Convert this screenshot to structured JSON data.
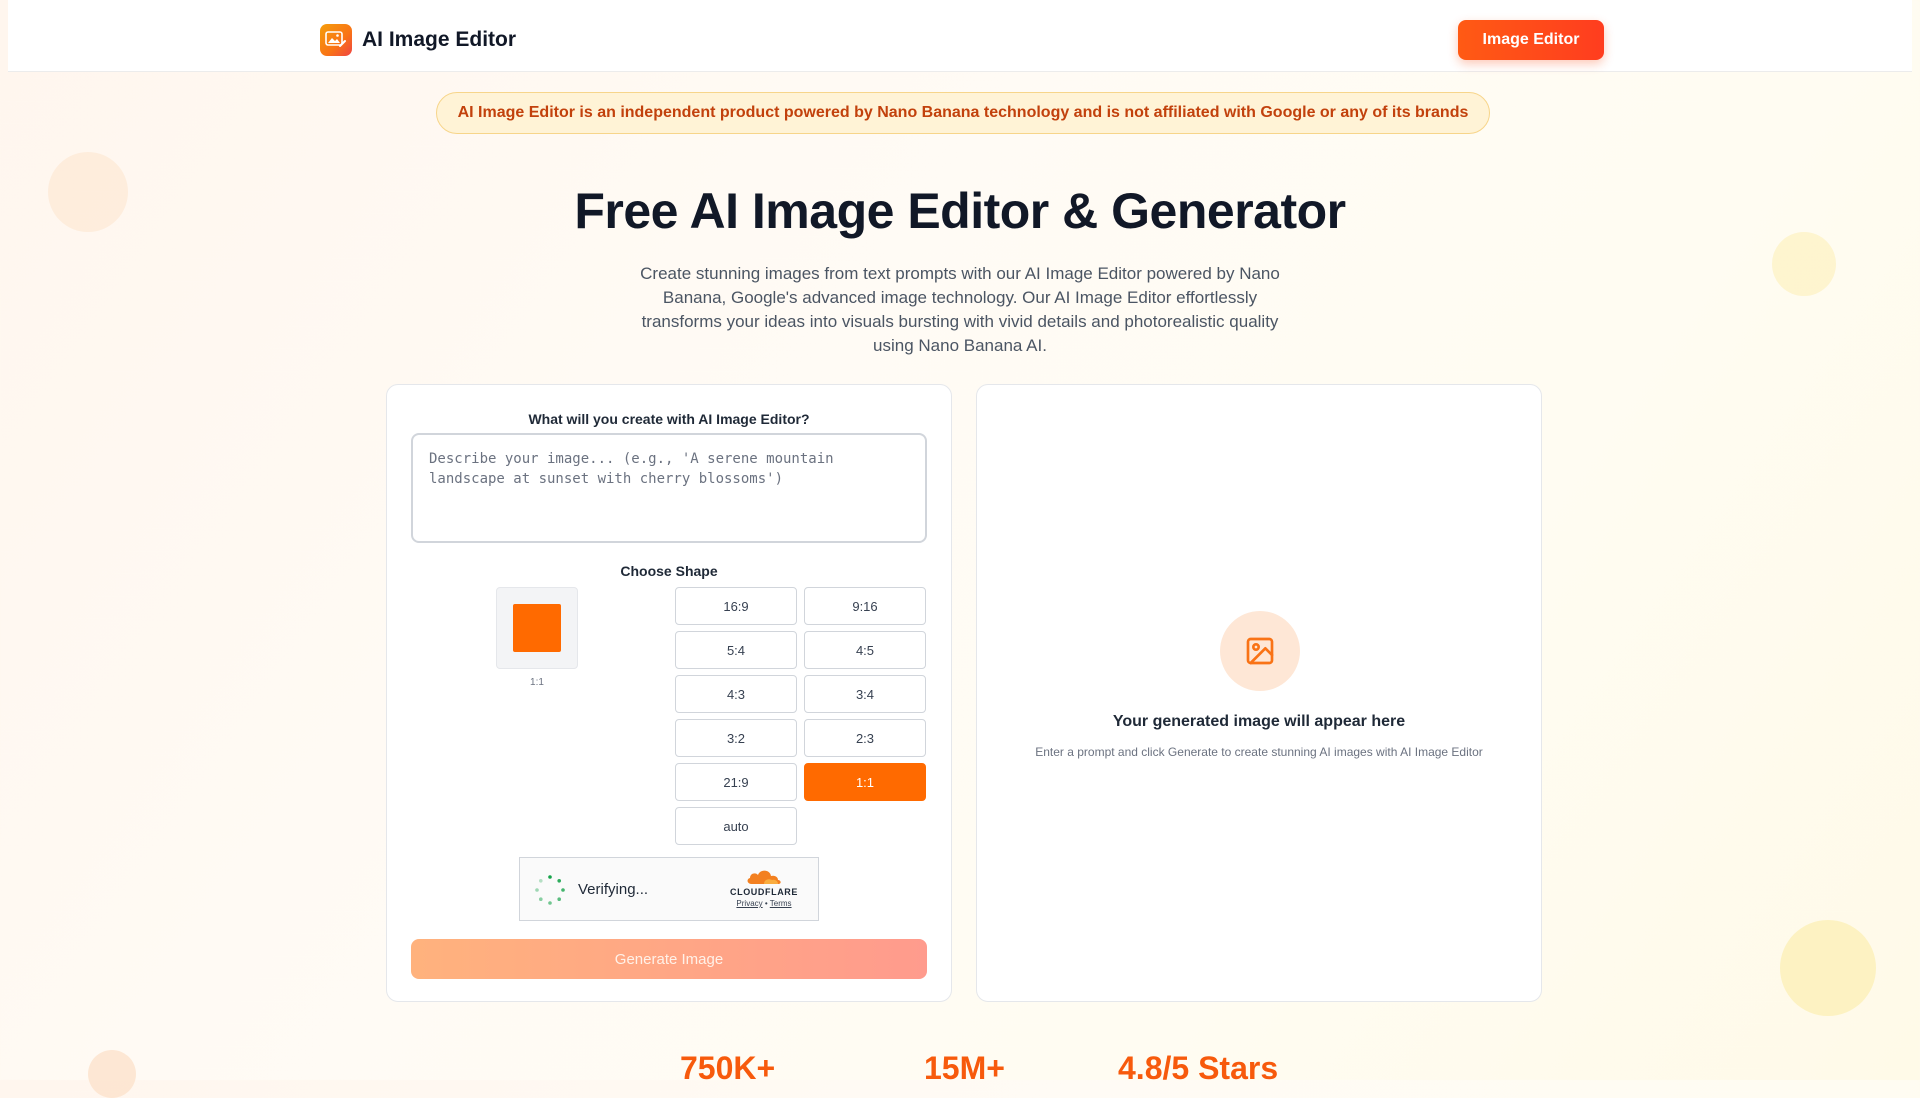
{
  "header": {
    "brand_name": "AI Image Editor",
    "cta_label": "Image Editor"
  },
  "notice": "AI Image Editor is an independent product powered by Nano Banana technology and is not affiliated with Google or any of its brands",
  "hero": {
    "title": "Free AI Image Editor & Generator",
    "description": "Create stunning images from text prompts with our AI Image Editor powered by Nano Banana, Google's advanced image technology. Our AI Image Editor effortlessly transforms your ideas into visuals bursting with vivid details and photorealistic quality using Nano Banana AI."
  },
  "generator": {
    "prompt_label": "What will you create with AI Image Editor?",
    "prompt_value": "",
    "prompt_placeholder": "Describe your image... (e.g., 'A serene mountain landscape at sunset with cherry blossoms')",
    "shape_label": "Choose Shape",
    "preview_caption": "1:1",
    "ratios": [
      "16:9",
      "9:16",
      "5:4",
      "4:5",
      "4:3",
      "3:4",
      "3:2",
      "2:3",
      "21:9",
      "1:1",
      "auto"
    ],
    "selected_ratio": "1:1",
    "captcha": {
      "status": "Verifying...",
      "brand": "CLOUDFLARE",
      "privacy": "Privacy",
      "separator": "•",
      "terms": "Terms"
    },
    "generate_label": "Generate Image"
  },
  "result": {
    "icon": "image-icon",
    "title": "Your generated image will appear here",
    "subtitle": "Enter a prompt and click Generate to create stunning AI images with AI Image Editor"
  },
  "stats": [
    "750K+",
    "15M+",
    "4.8/5 Stars"
  ],
  "colors": {
    "accent": "#ff6a00",
    "cta_gradient_start": "#ff5a14",
    "cta_gradient_end": "#ff3d1f",
    "notice_bg": "#fff3d6",
    "notice_text": "#c2410c",
    "stat_color": "#f75a0c"
  }
}
